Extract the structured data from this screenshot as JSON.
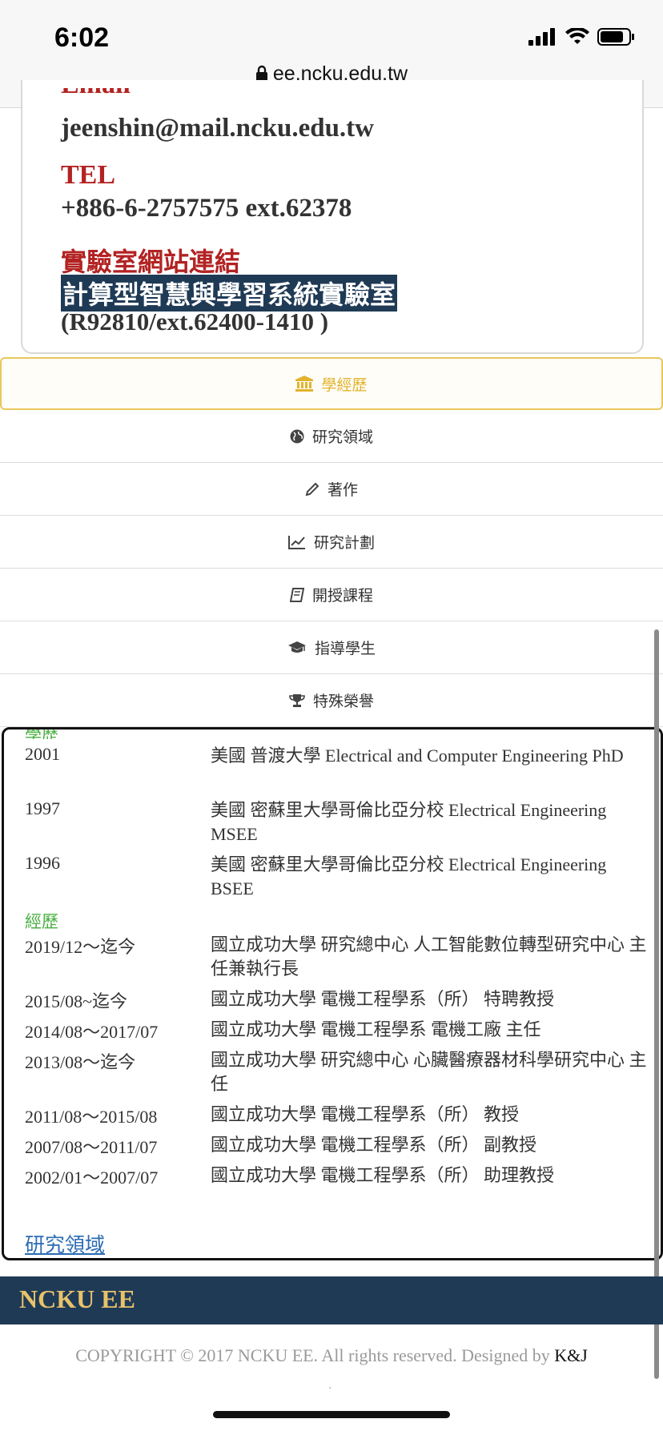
{
  "status": {
    "time": "6:02",
    "url": "ee.ncku.edu.tw"
  },
  "contact": {
    "email_label": "Email",
    "email": "jeenshin@mail.ncku.edu.tw",
    "tel_label": "TEL",
    "tel": "+886-6-2757575 ext.62378",
    "lab_label": "實驗室網站連結",
    "lab_name": "計算型智慧與學習系統實驗室",
    "lab_room": "(R92810/ext.62400-1410 )"
  },
  "tabs": [
    {
      "label": "學經歷",
      "icon": "bank-icon"
    },
    {
      "label": "研究領域",
      "icon": "globe-icon"
    },
    {
      "label": "著作",
      "icon": "pencil-icon"
    },
    {
      "label": "研究計劃",
      "icon": "chart-line-icon"
    },
    {
      "label": "開授課程",
      "icon": "book-icon"
    },
    {
      "label": "指導學生",
      "icon": "graduation-cap-icon"
    },
    {
      "label": "特殊榮譽",
      "icon": "trophy-icon"
    }
  ],
  "education": {
    "title": "學歷",
    "items": [
      {
        "year": "2001",
        "desc": "美國 普渡大學 Electrical and Computer Engineering PhD"
      },
      {
        "year": "1997",
        "desc": "美國 密蘇里大學哥倫比亞分校 Electrical Engineering MSEE"
      },
      {
        "year": "1996",
        "desc": "美國 密蘇里大學哥倫比亞分校 Electrical Engineering BSEE"
      }
    ]
  },
  "experience": {
    "title": "經歷",
    "items": [
      {
        "period": "2019/12～迄今",
        "desc": "國立成功大學 研究總中心 人工智能數位轉型研究中心 主任兼執行長"
      },
      {
        "period": "2015/08~迄今",
        "desc": "國立成功大學 電機工程學系（所） 特聘教授"
      },
      {
        "period": "2014/08～2017/07",
        "desc": "國立成功大學 電機工程學系 電機工廠 主任"
      },
      {
        "period": "2013/08～迄今",
        "desc": "國立成功大學 研究總中心 心臟醫療器材科學研究中心 主任"
      },
      {
        "period": "2011/08～2015/08",
        "desc": "國立成功大學 電機工程學系（所） 教授"
      },
      {
        "period": "2007/08～2011/07",
        "desc": "國立成功大學 電機工程學系（所） 副教授"
      },
      {
        "period": "2002/01～2007/07",
        "desc": "國立成功大學 電機工程學系（所） 助理教授"
      }
    ]
  },
  "research_link": "研究領域",
  "footer": {
    "brand": "NCKU EE",
    "copyright": "COPYRIGHT © 2017 NCKU EE. All rights reserved. Designed by ",
    "designer": "K&J",
    "dot": "."
  },
  "colors": {
    "accent": "#e2b32c",
    "label_red": "#b32222",
    "navy": "#1f3a55",
    "green": "#4bb043",
    "link": "#2b6cb3"
  }
}
